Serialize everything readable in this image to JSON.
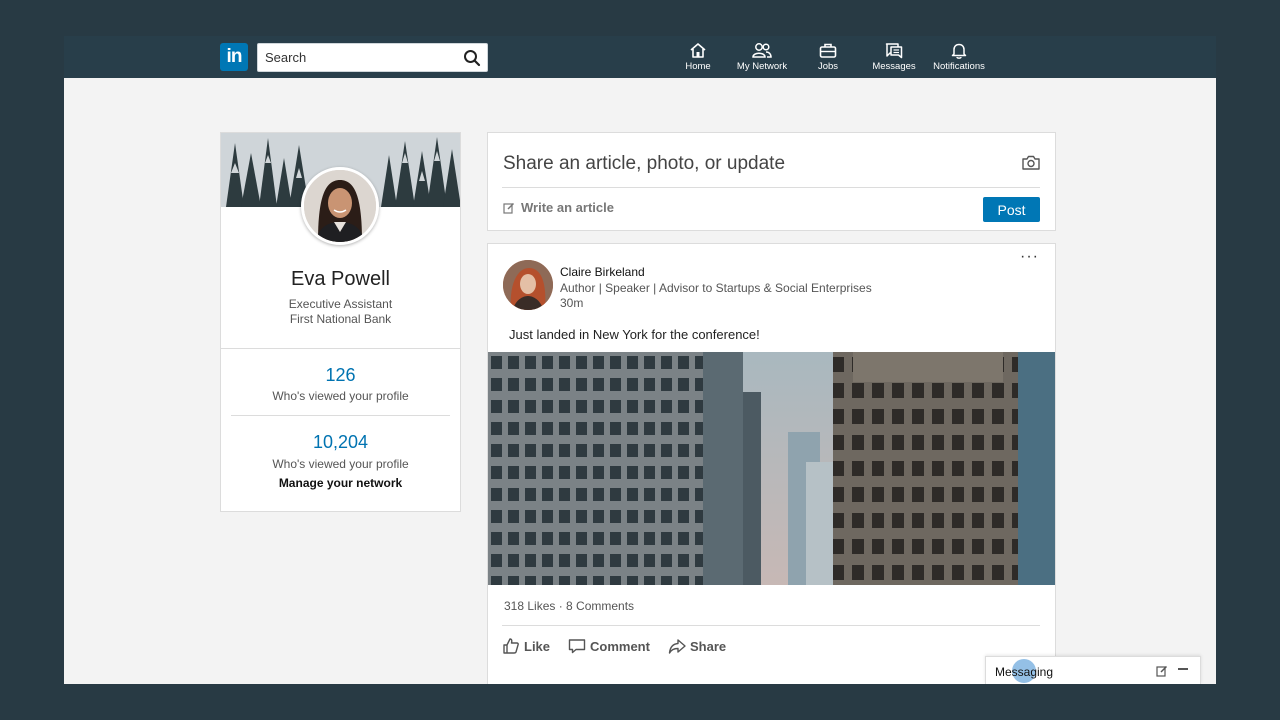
{
  "navbar": {
    "logo": "in",
    "search_placeholder": "Search",
    "items": [
      {
        "label": "Home",
        "icon": "home-icon"
      },
      {
        "label": "My Network",
        "icon": "network-icon"
      },
      {
        "label": "Jobs",
        "icon": "briefcase-icon"
      },
      {
        "label": "Messages",
        "icon": "messages-icon"
      },
      {
        "label": "Notifications",
        "icon": "bell-icon"
      }
    ]
  },
  "profile": {
    "name": "Eva Powell",
    "title": "Executive Assistant",
    "company": "First National Bank",
    "stats": [
      {
        "value": "126",
        "label": "Who's viewed your profile"
      },
      {
        "value": "10,204",
        "label": "Who's viewed your profile"
      }
    ],
    "manage_link": "Manage your network"
  },
  "share": {
    "prompt": "Share an article, photo, or update",
    "write_article": "Write an article",
    "post_label": "Post"
  },
  "post": {
    "author": "Claire Birkeland",
    "headline": "Author | Speaker | Advisor to Startups & Social Enterprises",
    "time": "30m",
    "text": "Just landed in New York for the conference!",
    "stats": "318 Likes · 8 Comments",
    "actions": {
      "like": "Like",
      "comment": "Comment",
      "share": "Share"
    }
  },
  "messaging": {
    "label": "Messaging"
  },
  "colors": {
    "nav_bg": "#283e4a",
    "brand": "#0077b5",
    "link": "#0073b1",
    "page_bg": "#f3f3f3"
  }
}
